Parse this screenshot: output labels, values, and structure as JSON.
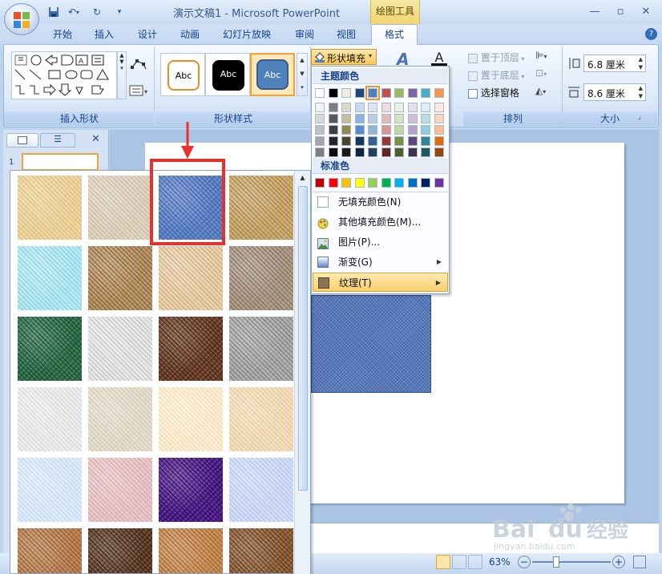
{
  "window": {
    "title": "演示文稿1 - Microsoft PowerPoint",
    "context_tab_title": "绘图工具"
  },
  "tabs": [
    {
      "label": "开始"
    },
    {
      "label": "插入"
    },
    {
      "label": "设计"
    },
    {
      "label": "动画"
    },
    {
      "label": "幻灯片放映"
    },
    {
      "label": "审阅"
    },
    {
      "label": "视图"
    }
  ],
  "active_tab": {
    "label": "格式"
  },
  "ribbon": {
    "insert_shapes_label": "插入形状",
    "shape_styles_label": "形状样式",
    "arrange_label": "排列",
    "size_label": "大小",
    "style_sample_text": "Abc",
    "shape_fill_label": "形状填充",
    "bring_to_front_label": "置于顶层",
    "send_to_back_label": "置于底层",
    "selection_pane_label": "选择窗格",
    "height_value": "6.8 厘米",
    "width_value": "8.6 厘米"
  },
  "fill_menu": {
    "theme_colors_label": "主题颜色",
    "standard_colors_label": "标准色",
    "theme_top_row": [
      "#ffffff",
      "#000000",
      "#eeece1",
      "#1f497d",
      "#4f81bd",
      "#c0504d",
      "#9bbb59",
      "#8064a2",
      "#4bacc6",
      "#f79646"
    ],
    "theme_shades": [
      [
        "#f2f2f2",
        "#7f7f7f",
        "#ddd9c3",
        "#c6d9f0",
        "#dbe5f1",
        "#f2dcdb",
        "#ebf1dd",
        "#e5e0ec",
        "#dbeef3",
        "#fdeada"
      ],
      [
        "#d8d8d8",
        "#595959",
        "#c4bd97",
        "#8db3e2",
        "#b8cce4",
        "#e5b9b7",
        "#d7e3bc",
        "#ccc1d9",
        "#b7dde8",
        "#fbd5b5"
      ],
      [
        "#bfbfbf",
        "#3f3f3f",
        "#938953",
        "#548dd4",
        "#95b3d7",
        "#d99694",
        "#c3d69b",
        "#b2a2c7",
        "#92cddc",
        "#fac08f"
      ],
      [
        "#a5a5a5",
        "#262626",
        "#494429",
        "#17365d",
        "#366092",
        "#953734",
        "#76923c",
        "#5f497a",
        "#31859b",
        "#e36c09"
      ],
      [
        "#7f7f7f",
        "#0c0c0c",
        "#1d1b10",
        "#0f243e",
        "#244061",
        "#632423",
        "#4f6128",
        "#3f3151",
        "#205867",
        "#974806"
      ]
    ],
    "standard_colors": [
      "#c00000",
      "#ff0000",
      "#ffc000",
      "#ffff00",
      "#92d050",
      "#00b050",
      "#00b0f0",
      "#0070c0",
      "#002060",
      "#7030a0"
    ],
    "items": [
      {
        "label": "无填充颜色(N)"
      },
      {
        "label": "其他填充颜色(M)..."
      },
      {
        "label": "图片(P)..."
      },
      {
        "label": "渐变(G)"
      },
      {
        "label": "纹理(T)"
      }
    ]
  },
  "status": {
    "zoom": "63%"
  },
  "slide_panel": {
    "slide_number": "1"
  },
  "textures": [
    {
      "name": "papyrus-texture",
      "c1": "#ecd39a",
      "c2": "#d9b878"
    },
    {
      "name": "canvas-texture",
      "c1": "#ddd2bf",
      "c2": "#c4b59c"
    },
    {
      "name": "denim-texture",
      "c1": "#5a7ec4",
      "c2": "#3f61a5"
    },
    {
      "name": "woven-mat-texture",
      "c1": "#c9a66a",
      "c2": "#9f7e45"
    },
    {
      "name": "water-droplets-texture",
      "c1": "#b5e7f0",
      "c2": "#7ccfe0"
    },
    {
      "name": "paper-bag-texture",
      "c1": "#b68f5e",
      "c2": "#7f5e38"
    },
    {
      "name": "fish-fossil-texture",
      "c1": "#e8cfa8",
      "c2": "#c8a57a"
    },
    {
      "name": "sand-texture",
      "c1": "#a99683",
      "c2": "#7f6c5a"
    },
    {
      "name": "green-marble-texture",
      "c1": "#2a6b46",
      "c2": "#174a2e"
    },
    {
      "name": "white-marble-texture",
      "c1": "#e6e6e6",
      "c2": "#bdbdbd"
    },
    {
      "name": "brown-marble-texture",
      "c1": "#6b3d24",
      "c2": "#3f2313"
    },
    {
      "name": "granite-texture",
      "c1": "#a8a8a8",
      "c2": "#7a7a7a"
    },
    {
      "name": "newsprint-texture",
      "c1": "#ececec",
      "c2": "#d3d3d3"
    },
    {
      "name": "recycled-paper-texture",
      "c1": "#e4dccb",
      "c2": "#cfc4ad"
    },
    {
      "name": "parchment-texture",
      "c1": "#fbecd0",
      "c2": "#f0dab2"
    },
    {
      "name": "stationery-texture",
      "c1": "#f1ddb8",
      "c2": "#e1c596"
    },
    {
      "name": "blue-tissue-texture",
      "c1": "#dbe9f8",
      "c2": "#bcd6f0"
    },
    {
      "name": "pink-tissue-texture",
      "c1": "#e8c4c8",
      "c2": "#d4a4aa"
    },
    {
      "name": "purple-mesh-texture",
      "c1": "#4b1a88",
      "c2": "#2e0c5e"
    },
    {
      "name": "bouquet-texture",
      "c1": "#cfdbf6",
      "c2": "#aebfea"
    },
    {
      "name": "cork-texture",
      "c1": "#b97d4c",
      "c2": "#8c5a33"
    },
    {
      "name": "walnut-texture",
      "c1": "#5c3a22",
      "c2": "#3a2212"
    },
    {
      "name": "oak-texture",
      "c1": "#c5884c",
      "c2": "#9b6330"
    },
    {
      "name": "medium-wood-texture",
      "c1": "#8a5a32",
      "c2": "#5e3a1c"
    }
  ],
  "watermark": {
    "brand": "Bai",
    "brand2": "du",
    "suffix": "经验",
    "url": "jingyan.baidu.com"
  }
}
